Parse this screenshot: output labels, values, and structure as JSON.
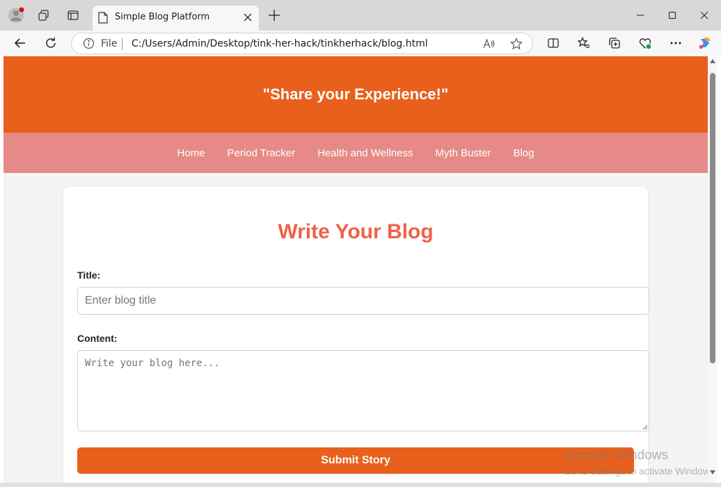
{
  "browser": {
    "tab_title": "Simple Blog Platform",
    "address_scheme": "File",
    "address_url": "C:/Users/Admin/Desktop/tink-her-hack/tinkherhack/blog.html"
  },
  "page": {
    "header_title": "\"Share your Experience!\"",
    "nav": [
      {
        "label": "Home"
      },
      {
        "label": "Period Tracker"
      },
      {
        "label": "Health and Wellness"
      },
      {
        "label": "Myth Buster"
      },
      {
        "label": "Blog"
      }
    ],
    "form": {
      "heading": "Write Your Blog",
      "title_label": "Title:",
      "title_placeholder": "Enter blog title",
      "title_value": "",
      "content_label": "Content:",
      "content_placeholder": "Write your blog here...",
      "content_value": "",
      "submit_label": "Submit Story"
    }
  },
  "os_watermark": {
    "line1": "Activate Windows",
    "line2": "Go to Settings to activate Windows."
  },
  "colors": {
    "header_bg": "#e8601c",
    "nav_bg": "#e68a88",
    "heading": "#ef6147",
    "button": "#e8601c"
  }
}
